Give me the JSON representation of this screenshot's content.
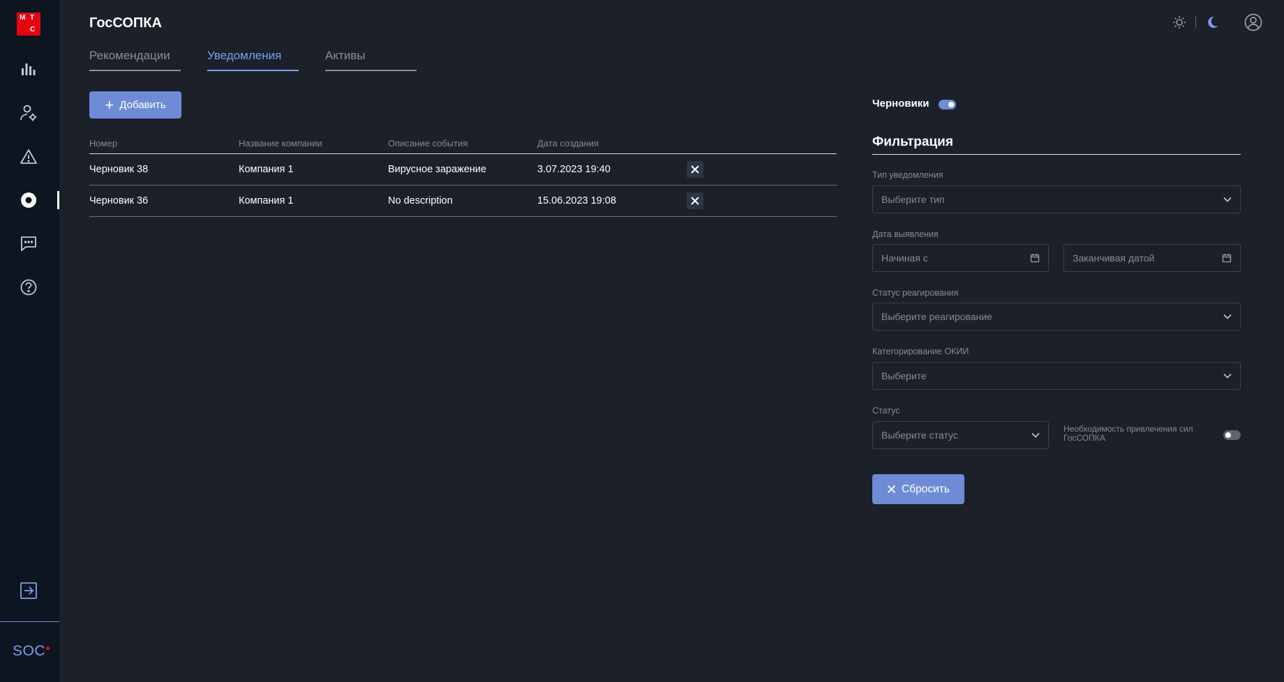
{
  "logo": {
    "letters": [
      "М",
      "Т",
      "С"
    ],
    "color": "#e30611"
  },
  "app": {
    "title": "ГосСОПКА"
  },
  "sidebar": {
    "items": [
      {
        "icon": "bar-chart-icon",
        "name": "analytics"
      },
      {
        "icon": "user-settings-icon",
        "name": "users"
      },
      {
        "icon": "warning-icon",
        "name": "incidents"
      },
      {
        "icon": "target-icon",
        "name": "gossopka",
        "active": true
      },
      {
        "icon": "chat-icon",
        "name": "messages"
      },
      {
        "icon": "help-icon",
        "name": "help"
      }
    ],
    "bottom": {
      "icon": "logout-icon"
    },
    "brand": "SOC"
  },
  "tabs": [
    {
      "label": "Рекомендации",
      "active": false
    },
    {
      "label": "Уведомления",
      "active": true
    },
    {
      "label": "Активы",
      "active": false
    }
  ],
  "toolbar": {
    "add_label": "Добавить"
  },
  "table": {
    "columns": [
      "Номер",
      "Название компании",
      "Описание события",
      "Дата создания"
    ],
    "rows": [
      {
        "number": "Черновик 38",
        "company": "Компания 1",
        "description": "Вирусное заражение",
        "date": "3.07.2023 19:40"
      },
      {
        "number": "Черновик 36",
        "company": "Компания 1",
        "description": "No description",
        "date": "15.06.2023 19:08"
      }
    ]
  },
  "drafts": {
    "label": "Черновики",
    "enabled": true
  },
  "filter": {
    "title": "Фильтрация",
    "notification_type": {
      "label": "Тип уведомления",
      "placeholder": "Выберите тип"
    },
    "detection_date": {
      "label": "Дата выявления",
      "from_placeholder": "Начиная с",
      "to_placeholder": "Заканчивая датой"
    },
    "response_status": {
      "label": "Статус реагирования",
      "placeholder": "Выберите реагирование"
    },
    "okii": {
      "label": "Категорирование ОКИИ",
      "placeholder": "Выберите"
    },
    "status": {
      "label": "Статус",
      "placeholder": "Выберите статус"
    },
    "need_forces": {
      "label": "Необходимость привлечения сил ГосСОПКА",
      "enabled": false
    },
    "reset_label": "Сбросить"
  },
  "colors": {
    "accent": "#6e8cd6",
    "background": "#1b2029",
    "sidebar": "#0d1520"
  }
}
